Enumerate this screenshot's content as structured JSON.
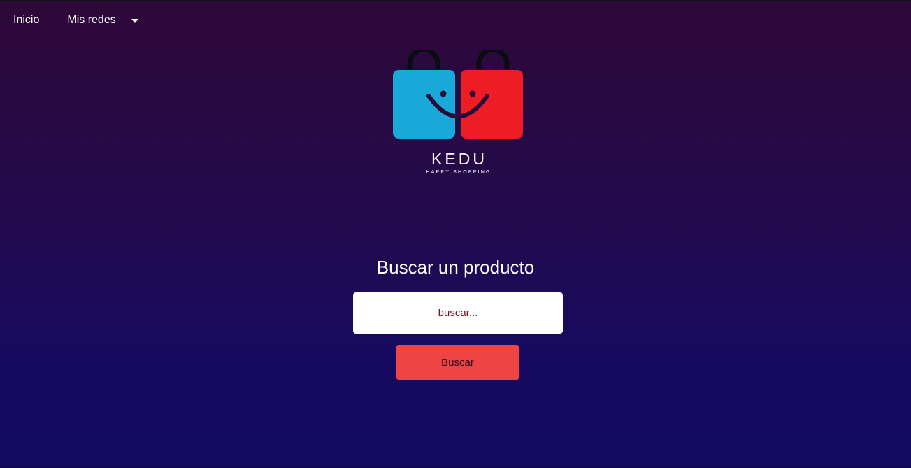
{
  "nav": {
    "home_label": "Inicio",
    "networks_label": "Mis redes",
    "networks_icon": "caret-down-icon"
  },
  "brand": {
    "name": "KEDU",
    "tagline": "HAPPY SHOPPING",
    "colors": {
      "left_bag": "#18a9d8",
      "right_bag": "#ee1c25",
      "handle": "#0b0b12",
      "face": "#2a0b3a"
    }
  },
  "search": {
    "title": "Buscar un producto",
    "placeholder": "buscar...",
    "value": "",
    "button_label": "Buscar"
  },
  "theme": {
    "background_top": "#2e0838",
    "background_bottom": "#120a63",
    "accent": "#ef4444"
  }
}
